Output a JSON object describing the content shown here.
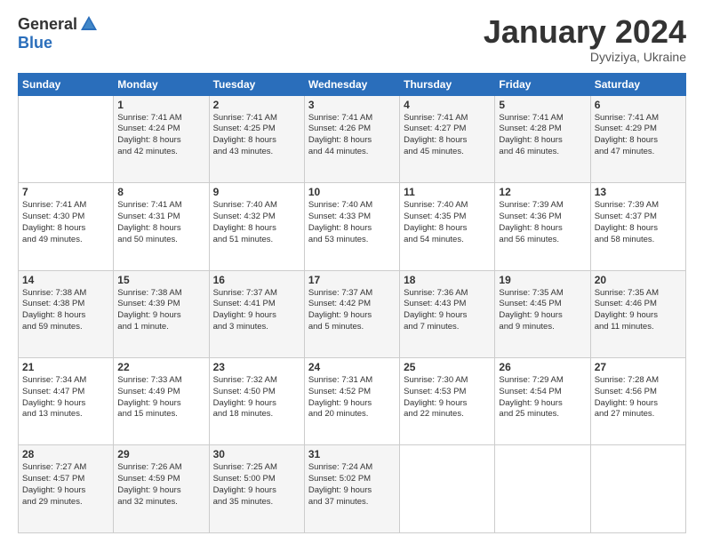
{
  "header": {
    "logo_general": "General",
    "logo_blue": "Blue",
    "month_title": "January 2024",
    "location": "Dyviziya, Ukraine"
  },
  "days_of_week": [
    "Sunday",
    "Monday",
    "Tuesday",
    "Wednesday",
    "Thursday",
    "Friday",
    "Saturday"
  ],
  "weeks": [
    [
      {
        "day": "",
        "info": ""
      },
      {
        "day": "1",
        "info": "Sunrise: 7:41 AM\nSunset: 4:24 PM\nDaylight: 8 hours\nand 42 minutes."
      },
      {
        "day": "2",
        "info": "Sunrise: 7:41 AM\nSunset: 4:25 PM\nDaylight: 8 hours\nand 43 minutes."
      },
      {
        "day": "3",
        "info": "Sunrise: 7:41 AM\nSunset: 4:26 PM\nDaylight: 8 hours\nand 44 minutes."
      },
      {
        "day": "4",
        "info": "Sunrise: 7:41 AM\nSunset: 4:27 PM\nDaylight: 8 hours\nand 45 minutes."
      },
      {
        "day": "5",
        "info": "Sunrise: 7:41 AM\nSunset: 4:28 PM\nDaylight: 8 hours\nand 46 minutes."
      },
      {
        "day": "6",
        "info": "Sunrise: 7:41 AM\nSunset: 4:29 PM\nDaylight: 8 hours\nand 47 minutes."
      }
    ],
    [
      {
        "day": "7",
        "info": "Sunrise: 7:41 AM\nSunset: 4:30 PM\nDaylight: 8 hours\nand 49 minutes."
      },
      {
        "day": "8",
        "info": "Sunrise: 7:41 AM\nSunset: 4:31 PM\nDaylight: 8 hours\nand 50 minutes."
      },
      {
        "day": "9",
        "info": "Sunrise: 7:40 AM\nSunset: 4:32 PM\nDaylight: 8 hours\nand 51 minutes."
      },
      {
        "day": "10",
        "info": "Sunrise: 7:40 AM\nSunset: 4:33 PM\nDaylight: 8 hours\nand 53 minutes."
      },
      {
        "day": "11",
        "info": "Sunrise: 7:40 AM\nSunset: 4:35 PM\nDaylight: 8 hours\nand 54 minutes."
      },
      {
        "day": "12",
        "info": "Sunrise: 7:39 AM\nSunset: 4:36 PM\nDaylight: 8 hours\nand 56 minutes."
      },
      {
        "day": "13",
        "info": "Sunrise: 7:39 AM\nSunset: 4:37 PM\nDaylight: 8 hours\nand 58 minutes."
      }
    ],
    [
      {
        "day": "14",
        "info": "Sunrise: 7:38 AM\nSunset: 4:38 PM\nDaylight: 8 hours\nand 59 minutes."
      },
      {
        "day": "15",
        "info": "Sunrise: 7:38 AM\nSunset: 4:39 PM\nDaylight: 9 hours\nand 1 minute."
      },
      {
        "day": "16",
        "info": "Sunrise: 7:37 AM\nSunset: 4:41 PM\nDaylight: 9 hours\nand 3 minutes."
      },
      {
        "day": "17",
        "info": "Sunrise: 7:37 AM\nSunset: 4:42 PM\nDaylight: 9 hours\nand 5 minutes."
      },
      {
        "day": "18",
        "info": "Sunrise: 7:36 AM\nSunset: 4:43 PM\nDaylight: 9 hours\nand 7 minutes."
      },
      {
        "day": "19",
        "info": "Sunrise: 7:35 AM\nSunset: 4:45 PM\nDaylight: 9 hours\nand 9 minutes."
      },
      {
        "day": "20",
        "info": "Sunrise: 7:35 AM\nSunset: 4:46 PM\nDaylight: 9 hours\nand 11 minutes."
      }
    ],
    [
      {
        "day": "21",
        "info": "Sunrise: 7:34 AM\nSunset: 4:47 PM\nDaylight: 9 hours\nand 13 minutes."
      },
      {
        "day": "22",
        "info": "Sunrise: 7:33 AM\nSunset: 4:49 PM\nDaylight: 9 hours\nand 15 minutes."
      },
      {
        "day": "23",
        "info": "Sunrise: 7:32 AM\nSunset: 4:50 PM\nDaylight: 9 hours\nand 18 minutes."
      },
      {
        "day": "24",
        "info": "Sunrise: 7:31 AM\nSunset: 4:52 PM\nDaylight: 9 hours\nand 20 minutes."
      },
      {
        "day": "25",
        "info": "Sunrise: 7:30 AM\nSunset: 4:53 PM\nDaylight: 9 hours\nand 22 minutes."
      },
      {
        "day": "26",
        "info": "Sunrise: 7:29 AM\nSunset: 4:54 PM\nDaylight: 9 hours\nand 25 minutes."
      },
      {
        "day": "27",
        "info": "Sunrise: 7:28 AM\nSunset: 4:56 PM\nDaylight: 9 hours\nand 27 minutes."
      }
    ],
    [
      {
        "day": "28",
        "info": "Sunrise: 7:27 AM\nSunset: 4:57 PM\nDaylight: 9 hours\nand 29 minutes."
      },
      {
        "day": "29",
        "info": "Sunrise: 7:26 AM\nSunset: 4:59 PM\nDaylight: 9 hours\nand 32 minutes."
      },
      {
        "day": "30",
        "info": "Sunrise: 7:25 AM\nSunset: 5:00 PM\nDaylight: 9 hours\nand 35 minutes."
      },
      {
        "day": "31",
        "info": "Sunrise: 7:24 AM\nSunset: 5:02 PM\nDaylight: 9 hours\nand 37 minutes."
      },
      {
        "day": "",
        "info": ""
      },
      {
        "day": "",
        "info": ""
      },
      {
        "day": "",
        "info": ""
      }
    ]
  ]
}
